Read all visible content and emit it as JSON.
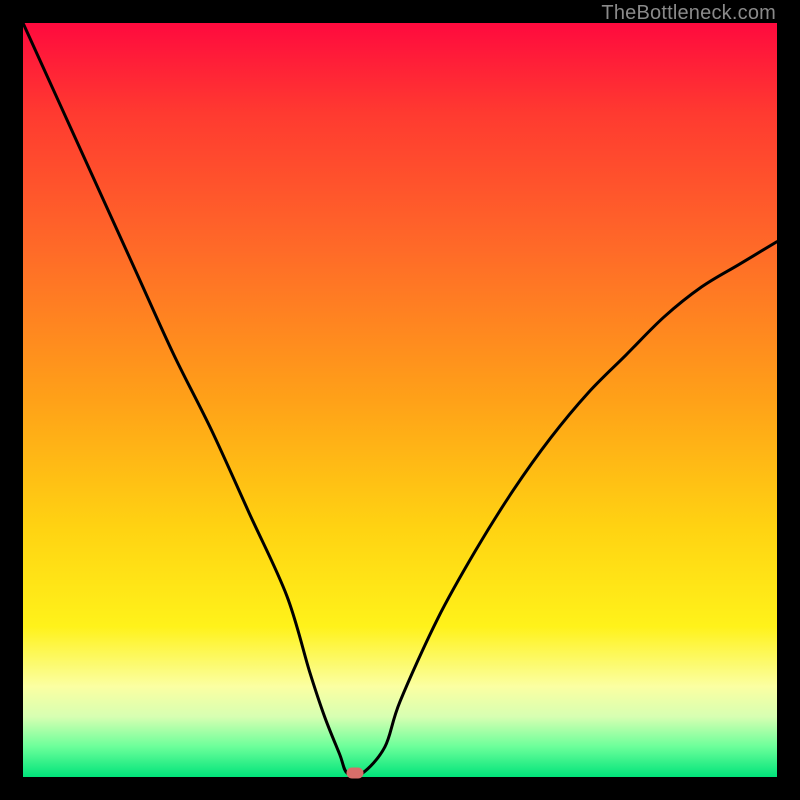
{
  "watermark": "TheBottleneck.com",
  "chart_data": {
    "type": "line",
    "title": "",
    "xlabel": "",
    "ylabel": "",
    "xlim": [
      0,
      100
    ],
    "ylim": [
      0,
      100
    ],
    "grid": false,
    "legend": false,
    "series": [
      {
        "name": "bottleneck-curve",
        "x": [
          0,
          5,
          10,
          15,
          20,
          25,
          30,
          35,
          38,
          40,
          42,
          43,
          45,
          48,
          50,
          55,
          60,
          65,
          70,
          75,
          80,
          85,
          90,
          95,
          100
        ],
        "y": [
          100,
          89,
          78,
          67,
          56,
          46,
          35,
          24,
          14,
          8,
          3,
          0.5,
          0.5,
          4,
          10,
          21,
          30,
          38,
          45,
          51,
          56,
          61,
          65,
          68,
          71
        ]
      }
    ],
    "marker": {
      "x": 44,
      "y": 0.5,
      "color": "#d76e6a"
    },
    "background_gradient": {
      "type": "vertical",
      "stops": [
        {
          "pos": 0,
          "color": "#00e37a"
        },
        {
          "pos": 8,
          "color": "#d7ffb2"
        },
        {
          "pos": 12,
          "color": "#fbffa2"
        },
        {
          "pos": 20,
          "color": "#fff21a"
        },
        {
          "pos": 33,
          "color": "#ffd312"
        },
        {
          "pos": 50,
          "color": "#ffa118"
        },
        {
          "pos": 70,
          "color": "#ff6a28"
        },
        {
          "pos": 88,
          "color": "#ff3a30"
        },
        {
          "pos": 100,
          "color": "#ff0a3e"
        }
      ]
    }
  }
}
